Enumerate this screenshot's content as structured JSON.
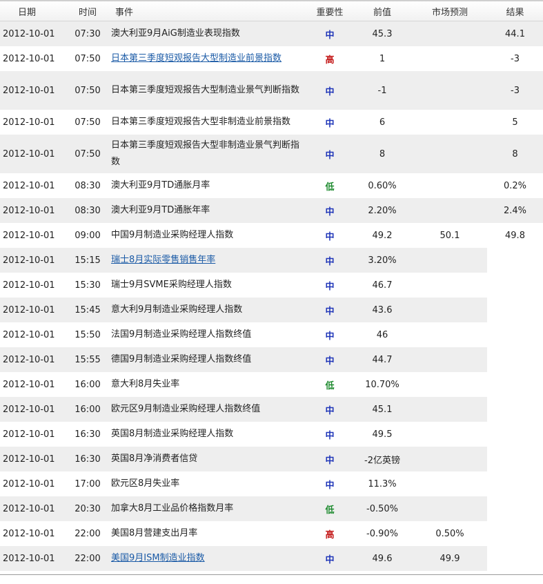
{
  "headers": {
    "date": "日期",
    "time": "时间",
    "event": "事件",
    "importance": "重要性",
    "previous": "前值",
    "forecast": "市场预测",
    "result": "结果"
  },
  "rows": [
    {
      "date": "2012-10-01",
      "time": "07:30",
      "event": "澳大利亚9月AiG制造业表现指数",
      "is_link": false,
      "importance": "中",
      "level": "mid",
      "previous": "45.3",
      "forecast": "",
      "result": "44.1",
      "shaded": true,
      "tall": false
    },
    {
      "date": "2012-10-01",
      "time": "07:50",
      "event": "日本第三季度短观报告大型制造业前景指数",
      "is_link": true,
      "importance": "高",
      "level": "high",
      "previous": "1",
      "forecast": "",
      "result": "-3",
      "shaded": false,
      "tall": false
    },
    {
      "date": "2012-10-01",
      "time": "07:50",
      "event": "日本第三季度短观报告大型制造业景气判断指数",
      "is_link": false,
      "importance": "中",
      "level": "mid",
      "previous": "-1",
      "forecast": "",
      "result": "-3",
      "shaded": true,
      "tall": true
    },
    {
      "date": "2012-10-01",
      "time": "07:50",
      "event": "日本第三季度短观报告大型非制造业前景指数",
      "is_link": false,
      "importance": "中",
      "level": "mid",
      "previous": "6",
      "forecast": "",
      "result": "5",
      "shaded": false,
      "tall": false
    },
    {
      "date": "2012-10-01",
      "time": "07:50",
      "event": "日本第三季度短观报告大型非制造业景气判断指数",
      "is_link": false,
      "importance": "中",
      "level": "mid",
      "previous": "8",
      "forecast": "",
      "result": "8",
      "shaded": true,
      "tall": true
    },
    {
      "date": "2012-10-01",
      "time": "08:30",
      "event": "澳大利亚9月TD通胀月率",
      "is_link": false,
      "importance": "低",
      "level": "low",
      "previous": "0.60%",
      "forecast": "",
      "result": "0.2%",
      "shaded": false,
      "tall": false
    },
    {
      "date": "2012-10-01",
      "time": "08:30",
      "event": "澳大利亚9月TD通胀年率",
      "is_link": false,
      "importance": "中",
      "level": "mid",
      "previous": "2.20%",
      "forecast": "",
      "result": "2.4%",
      "shaded": true,
      "tall": false
    },
    {
      "date": "2012-10-01",
      "time": "09:00",
      "event": "中国9月制造业采购经理人指数",
      "is_link": false,
      "importance": "中",
      "level": "mid",
      "previous": "49.2",
      "forecast": "50.1",
      "result": "49.8",
      "shaded": false,
      "tall": false
    },
    {
      "date": "2012-10-01",
      "time": "15:15",
      "event": "瑞士8月实际零售销售年率",
      "is_link": true,
      "importance": "中",
      "level": "mid",
      "previous": "3.20%",
      "forecast": "",
      "result": "",
      "shaded": true,
      "tall": false
    },
    {
      "date": "2012-10-01",
      "time": "15:30",
      "event": "瑞士9月SVME采购经理人指数",
      "is_link": false,
      "importance": "中",
      "level": "mid",
      "previous": "46.7",
      "forecast": "",
      "result": "",
      "shaded": false,
      "tall": false
    },
    {
      "date": "2012-10-01",
      "time": "15:45",
      "event": "意大利9月制造业采购经理人指数",
      "is_link": false,
      "importance": "中",
      "level": "mid",
      "previous": "43.6",
      "forecast": "",
      "result": "",
      "shaded": true,
      "tall": false
    },
    {
      "date": "2012-10-01",
      "time": "15:50",
      "event": "法国9月制造业采购经理人指数终值",
      "is_link": false,
      "importance": "中",
      "level": "mid",
      "previous": "46",
      "forecast": "",
      "result": "",
      "shaded": false,
      "tall": false
    },
    {
      "date": "2012-10-01",
      "time": "15:55",
      "event": "德国9月制造业采购经理人指数终值",
      "is_link": false,
      "importance": "中",
      "level": "mid",
      "previous": "44.7",
      "forecast": "",
      "result": "",
      "shaded": true,
      "tall": false
    },
    {
      "date": "2012-10-01",
      "time": "16:00",
      "event": "意大利8月失业率",
      "is_link": false,
      "importance": "低",
      "level": "low",
      "previous": "10.70%",
      "forecast": "",
      "result": "",
      "shaded": false,
      "tall": false
    },
    {
      "date": "2012-10-01",
      "time": "16:00",
      "event": "欧元区9月制造业采购经理人指数终值",
      "is_link": false,
      "importance": "中",
      "level": "mid",
      "previous": "45.1",
      "forecast": "",
      "result": "",
      "shaded": true,
      "tall": false
    },
    {
      "date": "2012-10-01",
      "time": "16:30",
      "event": "英国8月制造业采购经理人指数",
      "is_link": false,
      "importance": "中",
      "level": "mid",
      "previous": "49.5",
      "forecast": "",
      "result": "",
      "shaded": false,
      "tall": false
    },
    {
      "date": "2012-10-01",
      "time": "16:30",
      "event": "英国8月净消费者信贷",
      "is_link": false,
      "importance": "中",
      "level": "mid",
      "previous": "-2亿英镑",
      "forecast": "",
      "result": "",
      "shaded": true,
      "tall": false
    },
    {
      "date": "2012-10-01",
      "time": "17:00",
      "event": "欧元区8月失业率",
      "is_link": false,
      "importance": "中",
      "level": "mid",
      "previous": "11.3%",
      "forecast": "",
      "result": "",
      "shaded": false,
      "tall": false
    },
    {
      "date": "2012-10-01",
      "time": "20:30",
      "event": "加拿大8月工业品价格指数月率",
      "is_link": false,
      "importance": "低",
      "level": "low",
      "previous": "-0.50%",
      "forecast": "",
      "result": "",
      "shaded": true,
      "tall": false
    },
    {
      "date": "2012-10-01",
      "time": "22:00",
      "event": "美国8月营建支出月率",
      "is_link": false,
      "importance": "高",
      "level": "high",
      "previous": "-0.90%",
      "forecast": "0.50%",
      "result": "",
      "shaded": false,
      "tall": false
    },
    {
      "date": "2012-10-01",
      "time": "22:00",
      "event": "美国9月ISM制造业指数",
      "is_link": true,
      "importance": "中",
      "level": "mid",
      "previous": "49.6",
      "forecast": "49.9",
      "result": "",
      "shaded": true,
      "tall": false
    }
  ]
}
